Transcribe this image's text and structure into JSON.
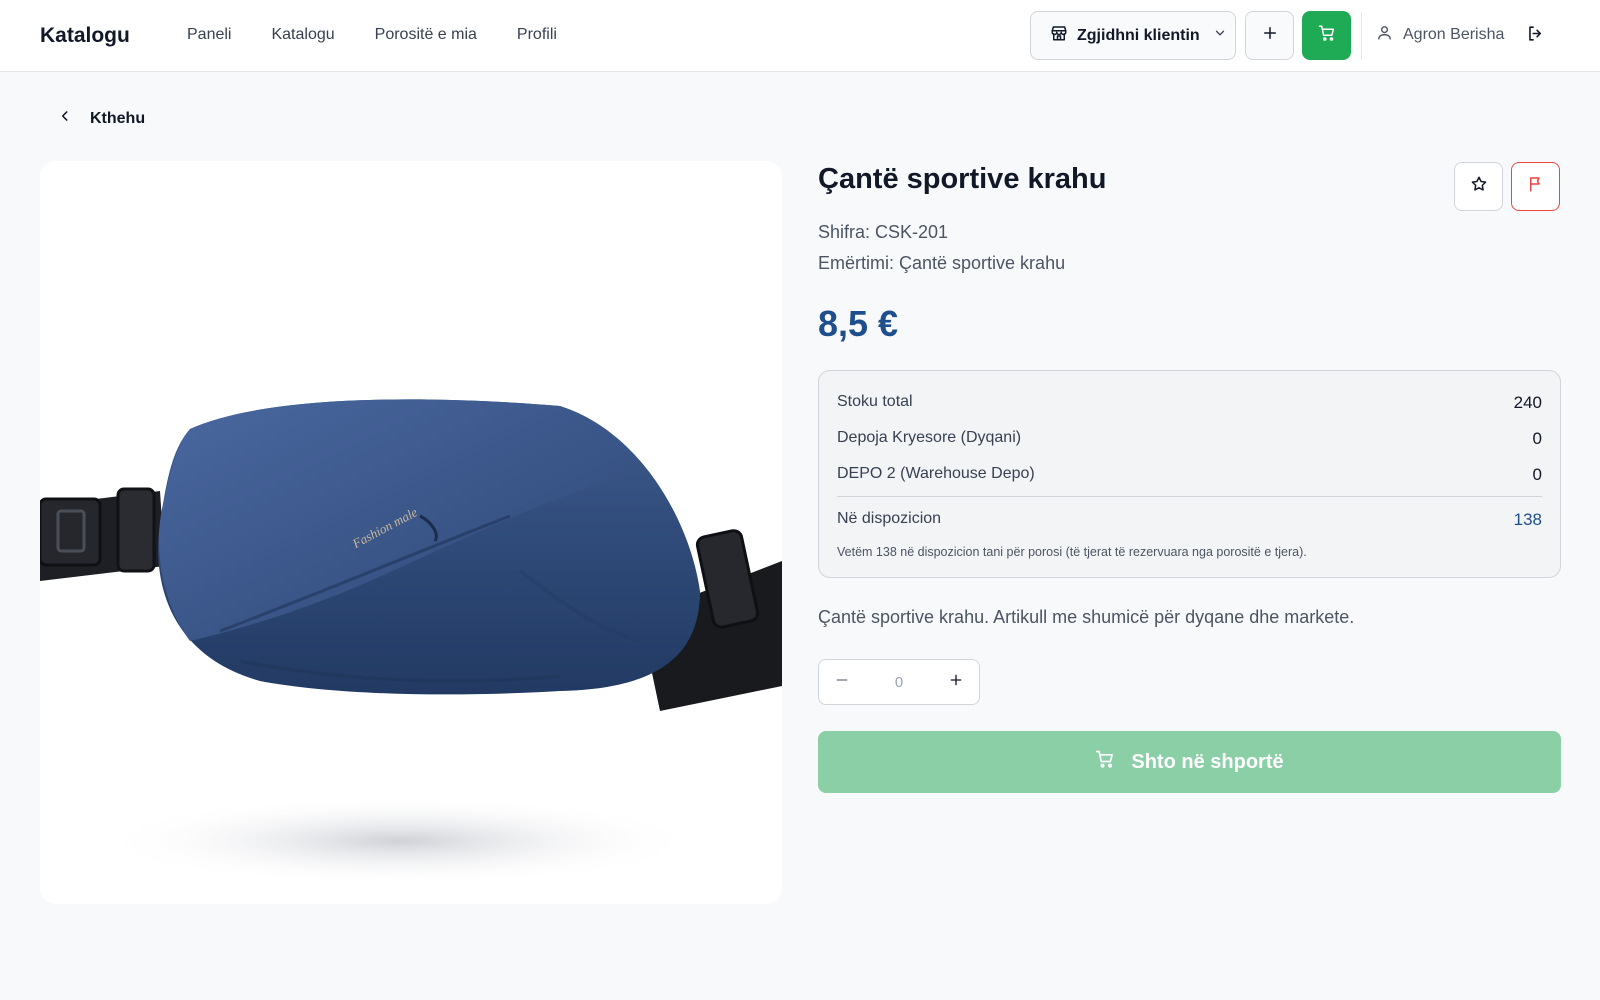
{
  "header": {
    "brand": "Katalogu",
    "nav": [
      "Paneli",
      "Katalogu",
      "Porositë e mia",
      "Profili"
    ],
    "client_select_label": "Zgjidhni klientin",
    "user_name": "Agron Berisha"
  },
  "back_label": "Kthehu",
  "product": {
    "title": "Çantë sportive krahu",
    "code_line": "Shifra: CSK-201",
    "name_line": "Emërtimi: Çantë sportive krahu",
    "price": "8,5 €",
    "image_text": "Fashion male",
    "description": "Çantë sportive krahu. Artikull me shumicë për dyqane dhe markete."
  },
  "stock": {
    "rows": [
      {
        "label": "Stoku total",
        "value": "240"
      },
      {
        "label": "Depoja Kryesore (Dyqani)",
        "value": "0"
      },
      {
        "label": "DEPO 2 (Warehouse Depo)",
        "value": "0"
      }
    ],
    "available_label": "Në dispozicion",
    "available_value": "138",
    "note": "Vetëm 138 në dispozicion tani për porosi (të tjerat të rezervuara nga porositë e tjera)."
  },
  "quantity": {
    "value": "0"
  },
  "add_to_cart_label": "Shto në shportë",
  "icons": {
    "store": "store-icon",
    "chevron": "chevron-down-icon",
    "plus": "plus-icon",
    "cart": "cart-icon",
    "user": "user-icon",
    "logout": "logout-icon",
    "back": "chevron-left-icon",
    "star": "star-icon",
    "flag": "flag-icon",
    "minus": "minus-icon"
  },
  "colors": {
    "accent_green": "#1faa55",
    "button_green_disabled": "#8bcfa6",
    "price_blue": "#1f4e8c",
    "flag_red": "#ef4444",
    "bag_navy": "#2f4a78"
  }
}
